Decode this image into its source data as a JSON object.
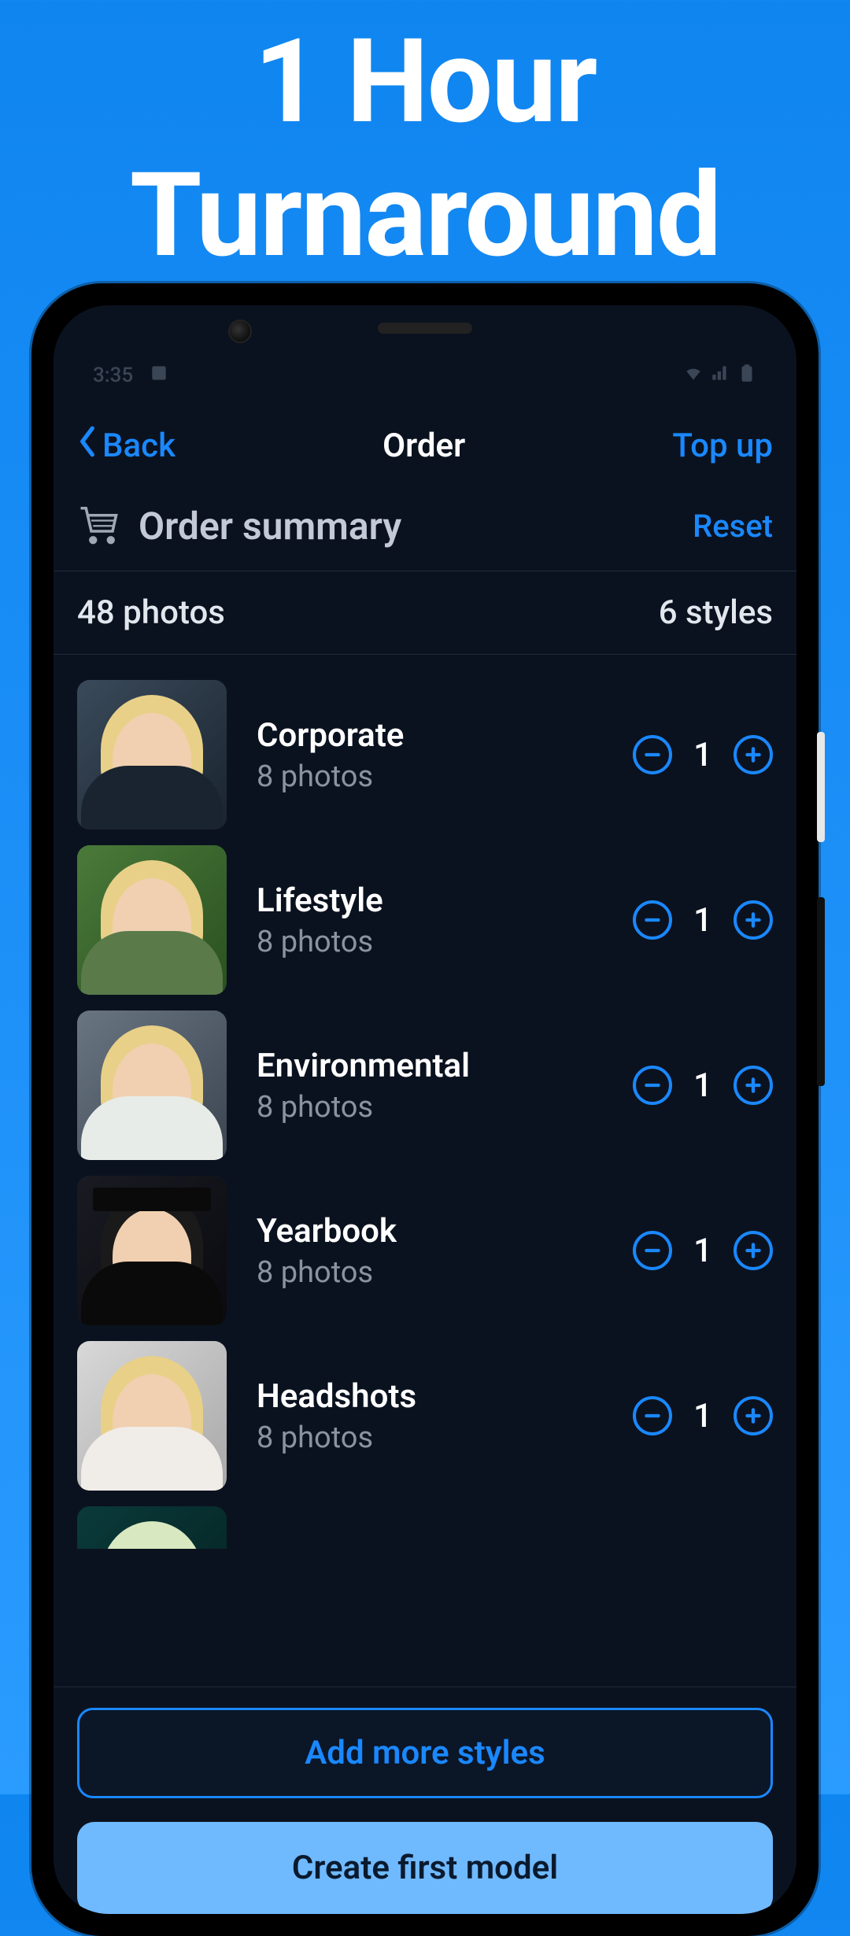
{
  "hero": {
    "title_line1": "1 Hour",
    "title_line2": "Turnaround"
  },
  "status_bar": {
    "time": "3:35"
  },
  "nav": {
    "back_label": "Back",
    "title": "Order",
    "topup_label": "Top up"
  },
  "summary": {
    "title": "Order summary",
    "reset_label": "Reset"
  },
  "totals": {
    "photos": "48 photos",
    "styles": "6 styles"
  },
  "styles": [
    {
      "name": "Corporate",
      "count_label": "8 photos",
      "qty": "1",
      "thumb_variant": "bg1",
      "body_variant": "body-dark",
      "hair_variant": ""
    },
    {
      "name": "Lifestyle",
      "count_label": "8 photos",
      "qty": "1",
      "thumb_variant": "bg2",
      "body_variant": "body-green",
      "hair_variant": ""
    },
    {
      "name": "Environmental",
      "count_label": "8 photos",
      "qty": "1",
      "thumb_variant": "bg3",
      "body_variant": "body-white",
      "hair_variant": ""
    },
    {
      "name": "Yearbook",
      "count_label": "8 photos",
      "qty": "1",
      "thumb_variant": "bg4",
      "body_variant": "body-black",
      "hair_variant": "dark",
      "grad_cap": true
    },
    {
      "name": "Headshots",
      "count_label": "8 photos",
      "qty": "1",
      "thumb_variant": "bg5",
      "body_variant": "body-light",
      "hair_variant": ""
    }
  ],
  "footer": {
    "add_more_label": "Add more styles",
    "create_model_label": "Create first model"
  },
  "colors": {
    "accent": "#1a88ff",
    "bg_dark": "#0b121f",
    "gradient_top": "#0f85f0",
    "gradient_bottom": "#2a9bff"
  }
}
